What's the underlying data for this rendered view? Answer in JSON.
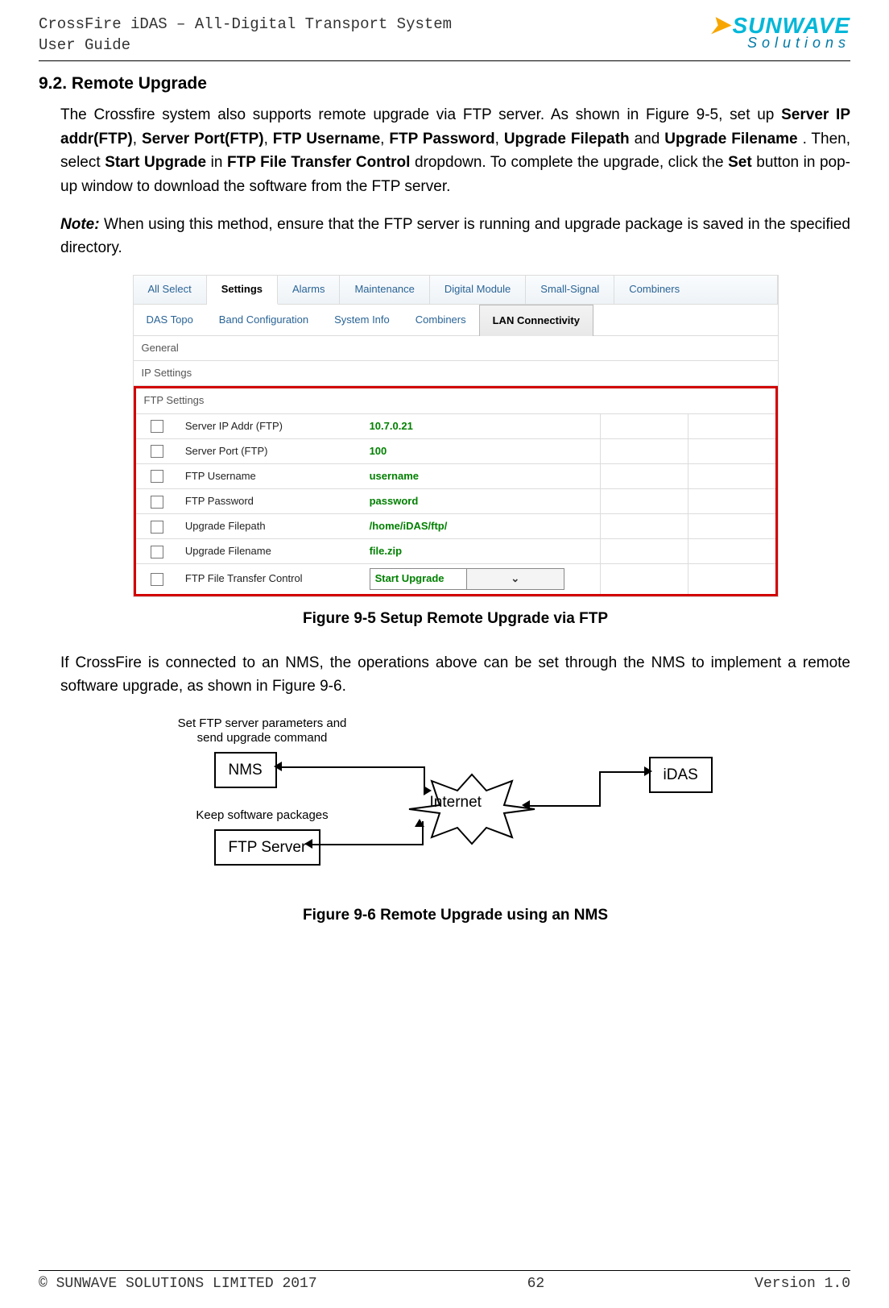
{
  "header": {
    "title_line1": "CrossFire iDAS – All-Digital Transport System",
    "title_line2": "User Guide",
    "logo_main": "SUNWAVE",
    "logo_sub": "Solutions"
  },
  "section_heading": "9.2. Remote Upgrade",
  "para1_parts": {
    "p1": "The Crossfire system also supports remote upgrade via FTP server. As shown in Figure 9-5, set up ",
    "b1": "Server IP addr(FTP)",
    "c1": ", ",
    "b2": "Server Port(FTP)",
    "c2": ", ",
    "b3": "FTP Username",
    "c3": ", ",
    "b4": "FTP Password",
    "c4": ", ",
    "b5": "Upgrade Filepath",
    "c5": " and ",
    "b6": "Upgrade Filename",
    "p2": ". Then, select ",
    "b7": "Start Upgrade",
    "p3": " in ",
    "b8": "FTP File Transfer Control",
    "p4": " dropdown. To complete the upgrade, click the ",
    "b9": "Set",
    "p5": " button in pop-up window to download the software from the FTP server."
  },
  "note": {
    "label": "Note:",
    "text": " When using this method, ensure that the FTP server is running and upgrade package is saved in the specified directory."
  },
  "shot": {
    "tabs1": [
      "All Select",
      "Settings",
      "Alarms",
      "Maintenance",
      "Digital Module",
      "Small-Signal",
      "Combiners"
    ],
    "tabs1_active": 1,
    "tabs2": [
      "DAS Topo",
      "Band Configuration",
      "System Info",
      "Combiners",
      "LAN Connectivity"
    ],
    "tabs2_active": 4,
    "sec_general": "General",
    "sec_ip": "IP Settings",
    "sec_ftp": "FTP Settings",
    "rows": [
      {
        "label": "Server IP Addr (FTP)",
        "value": "10.7.0.21",
        "dropdown": false
      },
      {
        "label": "Server Port (FTP)",
        "value": "100",
        "dropdown": false
      },
      {
        "label": "FTP Username",
        "value": "username",
        "dropdown": false
      },
      {
        "label": "FTP Password",
        "value": "password",
        "dropdown": false
      },
      {
        "label": "Upgrade Filepath",
        "value": "/home/iDAS/ftp/",
        "dropdown": false
      },
      {
        "label": "Upgrade Filename",
        "value": "file.zip",
        "dropdown": false
      },
      {
        "label": "FTP File Transfer Control",
        "value": "Start Upgrade",
        "dropdown": true
      }
    ]
  },
  "fig1_caption": "Figure 9-5 Setup Remote Upgrade via FTP",
  "para2": "If CrossFire is connected to an NMS, the operations above can be set through the NMS to implement a remote software upgrade, as shown in Figure 9-6.",
  "diagram": {
    "label_nms_top1": "Set FTP server parameters and",
    "label_nms_top2": "send upgrade command",
    "nms": "NMS",
    "label_ftp_top": "Keep software packages",
    "ftp": "FTP Server",
    "internet": "Internet",
    "idas": "iDAS"
  },
  "fig2_caption": "Figure 9-6 Remote Upgrade using an NMS",
  "footer": {
    "copyright": "© SUNWAVE SOLUTIONS LIMITED 2017",
    "page": "62",
    "version": "Version 1.0"
  }
}
